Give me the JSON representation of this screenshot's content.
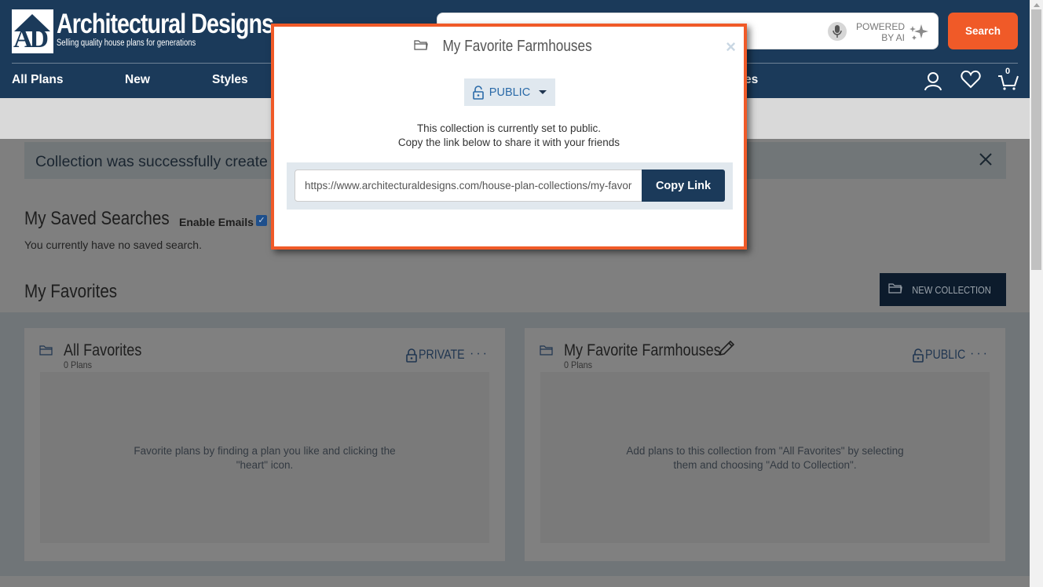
{
  "header": {
    "logo_title": "Architectural Designs",
    "logo_tagline": "Selling quality house plans for generations",
    "logo_mark": "AD",
    "search": {
      "placeholder": "",
      "powered_line1": "POWERED",
      "powered_line2": "BY AI",
      "button_label": "Search"
    },
    "nav": [
      {
        "label": "All Plans"
      },
      {
        "label": "New"
      },
      {
        "label": "Styles"
      },
      {
        "label": "es"
      }
    ],
    "cart_count": "0",
    "icons": [
      "user-icon",
      "heart-icon",
      "cart-icon",
      "microphone-icon",
      "sparkle-icon"
    ]
  },
  "alert": {
    "text": "Collection was successfully create",
    "close_icon": "close-icon"
  },
  "saved_searches": {
    "title": "My Saved Searches",
    "enable_emails_label": "Enable Emails",
    "enable_emails_checked": true,
    "empty_text": "You currently have no saved search."
  },
  "favorites": {
    "title": "My Favorites",
    "new_collection_label": "NEW COLLECTION",
    "collections": [
      {
        "name": "All Favorites",
        "count": "0 Plans",
        "privacy": "PRIVATE",
        "more": "···",
        "empty_text": "Favorite plans by finding a plan you like and clicking the \"heart\" icon."
      },
      {
        "name": "My Favorite Farmhouses",
        "count": "0 Plans",
        "privacy": "PUBLIC",
        "more": "···",
        "empty_text": "Add plans to this collection from \"All Favorites\" by selecting them and choosing \"Add to Collection\"."
      }
    ]
  },
  "modal": {
    "title": "My Favorite Farmhouses",
    "close": "×",
    "privacy_value": "PUBLIC",
    "desc_line1": "This collection is currently set to public.",
    "desc_line2": "Copy the link below to share it with your friends",
    "link_value": "https://www.architecturaldesigns.com/house-plan-collections/my-favorite-farmhouses",
    "copy_label": "Copy Link"
  },
  "colors": {
    "brand_navy": "#1b3a5a",
    "accent_orange": "#f05a28",
    "public_blue": "#2a6aa8"
  }
}
